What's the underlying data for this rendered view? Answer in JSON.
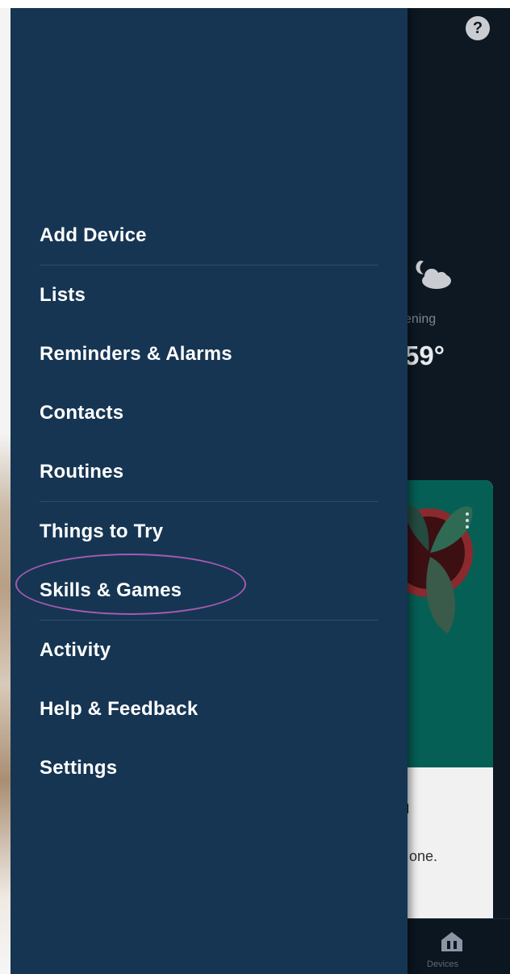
{
  "header": {
    "help_glyph": "?"
  },
  "weather": {
    "icon": "cloud-moon-icon",
    "caption": "vening",
    "temperature": "59°"
  },
  "card": {
    "mark_text": "'",
    "body_text": "one."
  },
  "bottom_nav": {
    "devices_icon": "devices-icon",
    "devices_label": "Devices"
  },
  "drawer": {
    "items": [
      {
        "label": "Add Device"
      },
      {
        "label": "Lists"
      },
      {
        "label": "Reminders & Alarms"
      },
      {
        "label": "Contacts"
      },
      {
        "label": "Routines"
      },
      {
        "label": "Things to Try"
      },
      {
        "label": "Skills & Games"
      },
      {
        "label": "Activity"
      },
      {
        "label": "Help & Feedback"
      },
      {
        "label": "Settings"
      }
    ]
  },
  "colors": {
    "drawer_bg": "#163553",
    "app_bg": "#0d1822",
    "card_accent": "#055f55",
    "highlight": "#a65ab0"
  }
}
